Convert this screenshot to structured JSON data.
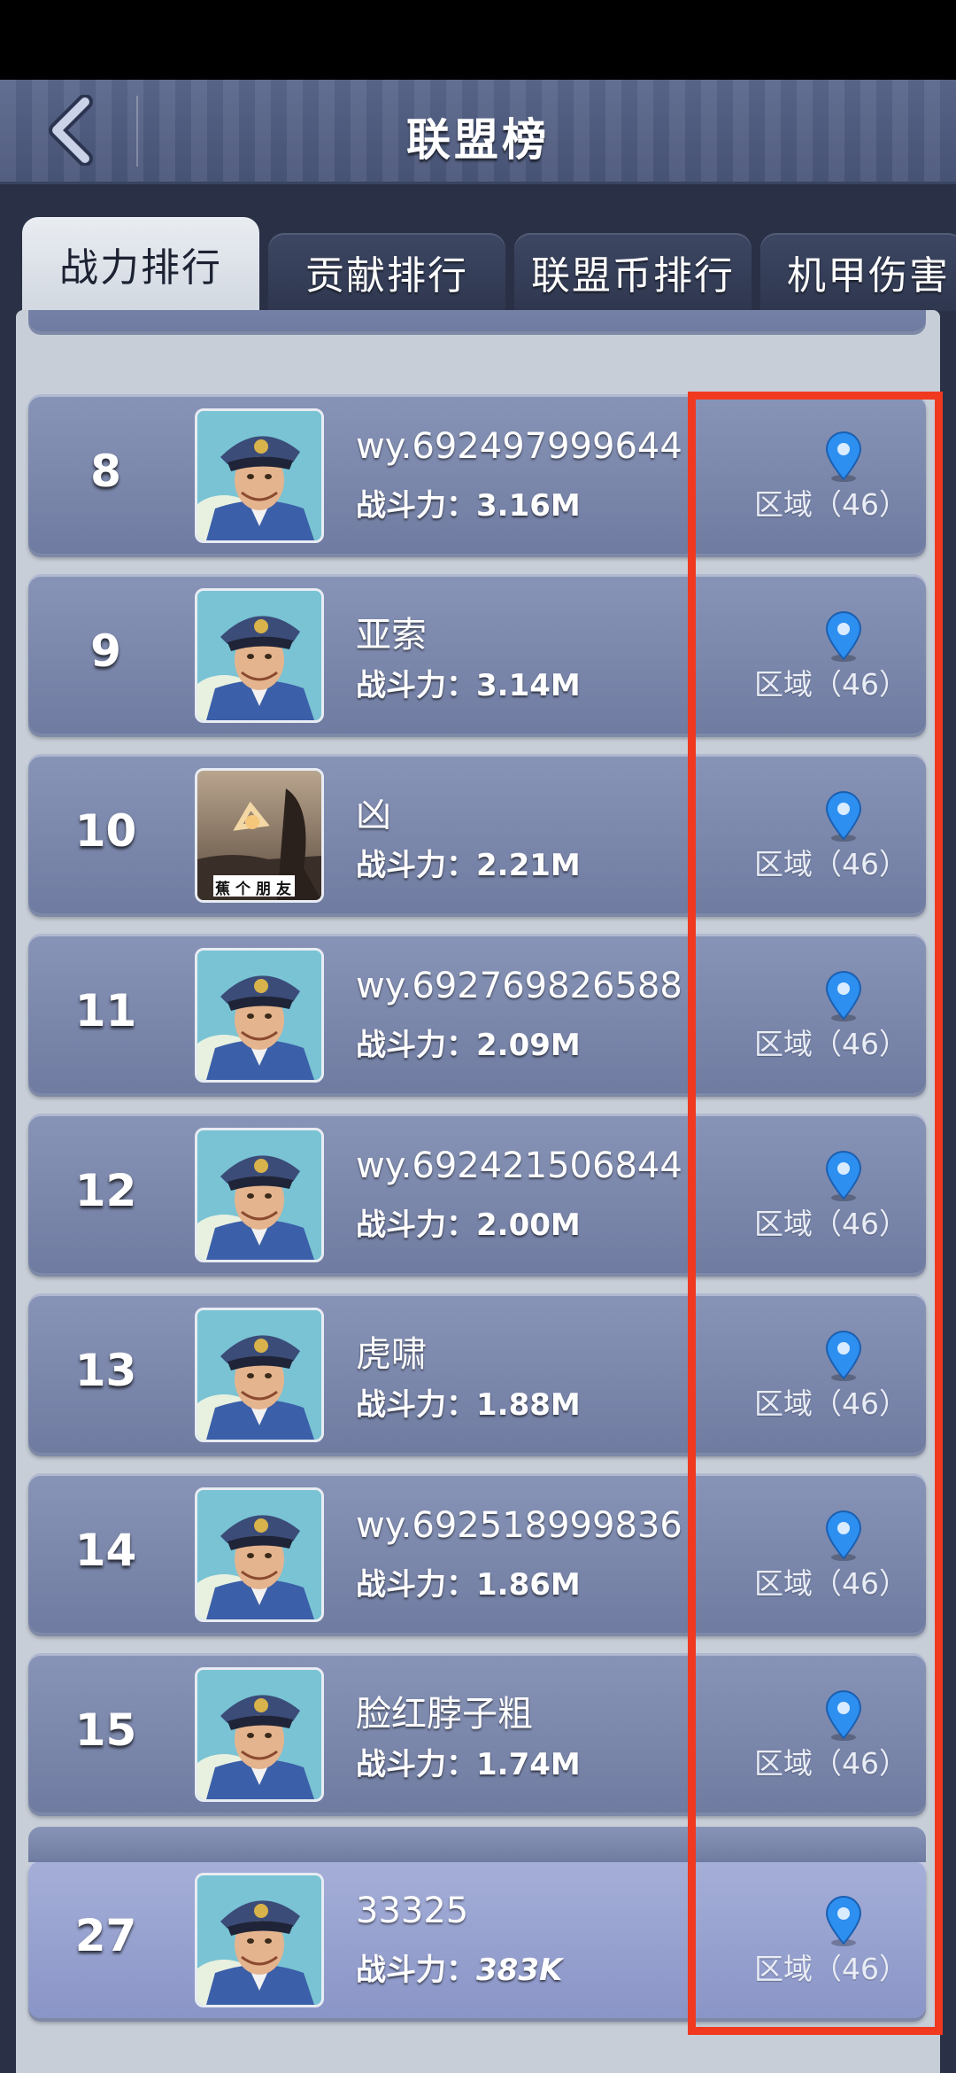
{
  "header": {
    "title": "联盟榜",
    "back_icon": "chevron-left-icon"
  },
  "tabs": [
    {
      "label": "战力排行",
      "active": true
    },
    {
      "label": "贡献排行",
      "active": false
    },
    {
      "label": "联盟币排行",
      "active": false
    },
    {
      "label": "机甲伤害",
      "active": false
    }
  ],
  "ranking": {
    "power_label": "战斗力：",
    "rows": [
      {
        "rank": "8",
        "name": "wy.692497999644",
        "power": "3.16M",
        "region": "区域（46）",
        "avatar": "captain-avatar"
      },
      {
        "rank": "9",
        "name": "亚索",
        "power": "3.14M",
        "region": "区域（46）",
        "avatar": "captain-avatar"
      },
      {
        "rank": "10",
        "name": "凶",
        "power": "2.21M",
        "region": "区域（46）",
        "avatar": "photo-avatar",
        "avatar_caption": "蕉个朋友"
      },
      {
        "rank": "11",
        "name": "wy.692769826588",
        "power": "2.09M",
        "region": "区域（46）",
        "avatar": "captain-avatar"
      },
      {
        "rank": "12",
        "name": "wy.692421506844",
        "power": "2.00M",
        "region": "区域（46）",
        "avatar": "captain-avatar"
      },
      {
        "rank": "13",
        "name": "虎啸",
        "power": "1.88M",
        "region": "区域（46）",
        "avatar": "captain-avatar"
      },
      {
        "rank": "14",
        "name": "wy.692518999836",
        "power": "1.86M",
        "region": "区域（46）",
        "avatar": "captain-avatar"
      },
      {
        "rank": "15",
        "name": "脸红脖子粗",
        "power": "1.74M",
        "region": "区域（46）",
        "avatar": "captain-avatar"
      }
    ],
    "self": {
      "rank": "27",
      "name": "33325",
      "power": "383K",
      "region": "区域（46）",
      "avatar": "captain-avatar"
    }
  },
  "colors": {
    "highlight": "#f0391f",
    "pin": "#2d8ff0"
  }
}
